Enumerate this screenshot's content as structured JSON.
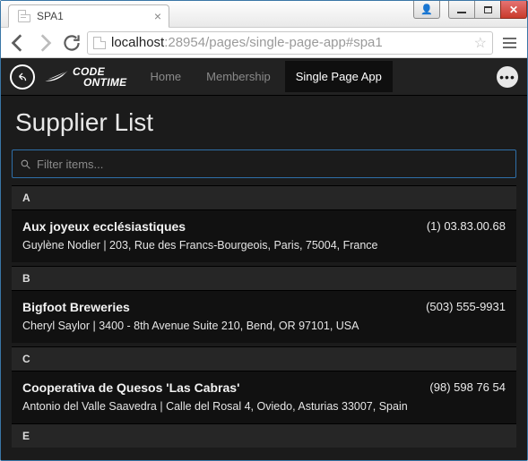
{
  "window": {
    "tab_title": "SPA1"
  },
  "browser": {
    "url_host": "localhost",
    "url_rest": ":28954/pages/single-page-app#spa1"
  },
  "header": {
    "logo_line1": "CODE",
    "logo_line2": "ONTIME",
    "nav": [
      {
        "label": "Home",
        "active": false
      },
      {
        "label": "Membership",
        "active": false
      },
      {
        "label": "Single Page App",
        "active": true
      }
    ]
  },
  "page": {
    "title": "Supplier List",
    "filter_placeholder": "Filter items..."
  },
  "list": {
    "sections": [
      {
        "letter": "A",
        "rows": [
          {
            "name": "Aux joyeux ecclésiastiques",
            "phone": "(1) 03.83.00.68",
            "sub": "Guylène Nodier | 203, Rue des Francs-Bourgeois, Paris, 75004, France"
          }
        ]
      },
      {
        "letter": "B",
        "rows": [
          {
            "name": "Bigfoot Breweries",
            "phone": "(503) 555-9931",
            "sub": "Cheryl Saylor | 3400 - 8th Avenue Suite 210, Bend, OR 97101, USA"
          }
        ]
      },
      {
        "letter": "C",
        "rows": [
          {
            "name": "Cooperativa de Quesos 'Las Cabras'",
            "phone": "(98) 598 76 54",
            "sub": "Antonio del Valle Saavedra | Calle del Rosal 4, Oviedo, Asturias 33007, Spain"
          }
        ]
      },
      {
        "letter": "E",
        "rows": []
      }
    ]
  }
}
